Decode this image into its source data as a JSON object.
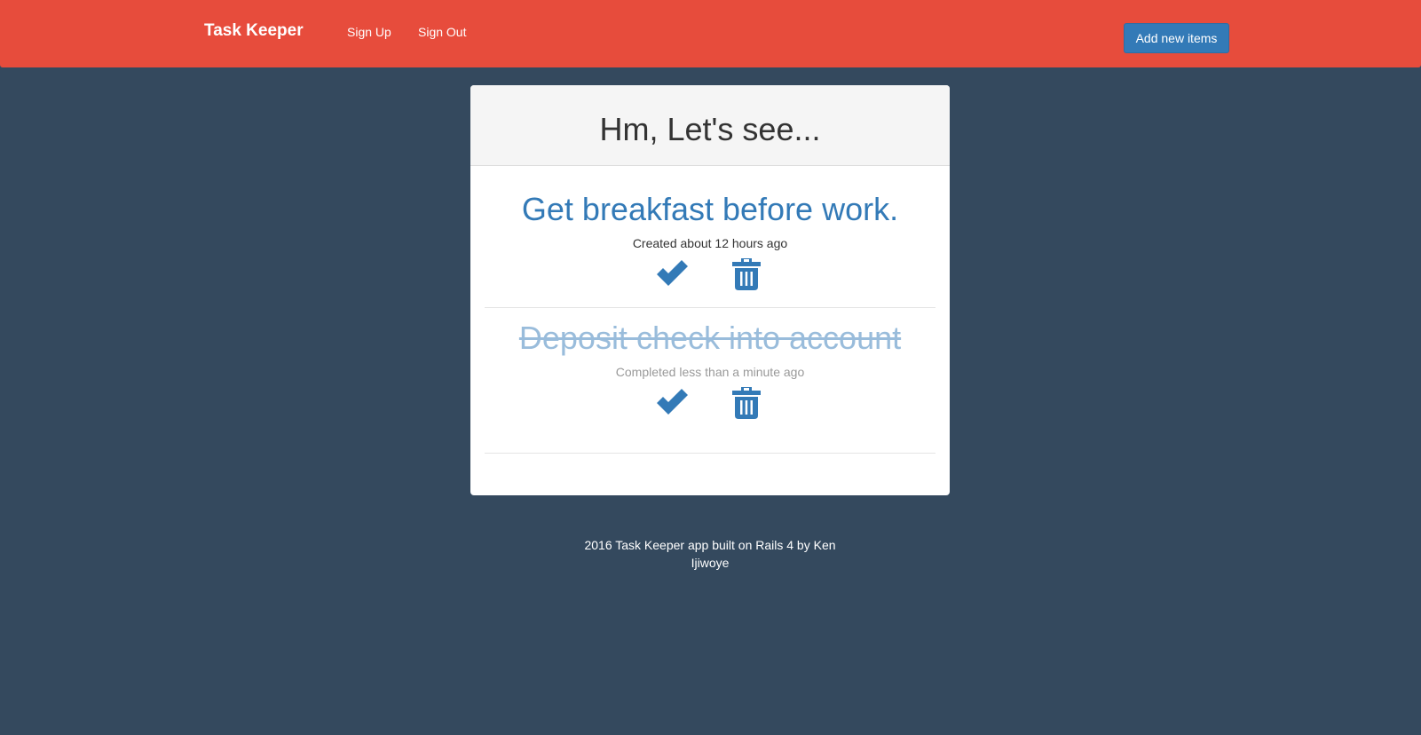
{
  "navbar": {
    "brand": "Task Keeper",
    "links": [
      "Sign Up",
      "Sign Out"
    ],
    "add_button": "Add new items"
  },
  "panel": {
    "title": "Hm, Let's see...",
    "items": [
      {
        "title": "Get breakfast before work.",
        "meta": "Created about 12 hours ago",
        "completed": false
      },
      {
        "title": "Deposit check into account",
        "meta": "Completed less than a minute ago",
        "completed": true
      }
    ]
  },
  "icons": {
    "complete": "check-icon",
    "delete": "trash-icon"
  },
  "colors": {
    "navbar": "#e74c3c",
    "background": "#34495e",
    "accent": "#337ab7"
  },
  "footer": {
    "line1": "2016 Task Keeper app built on Rails 4 by Ken",
    "line2": "Ijiwoye"
  }
}
